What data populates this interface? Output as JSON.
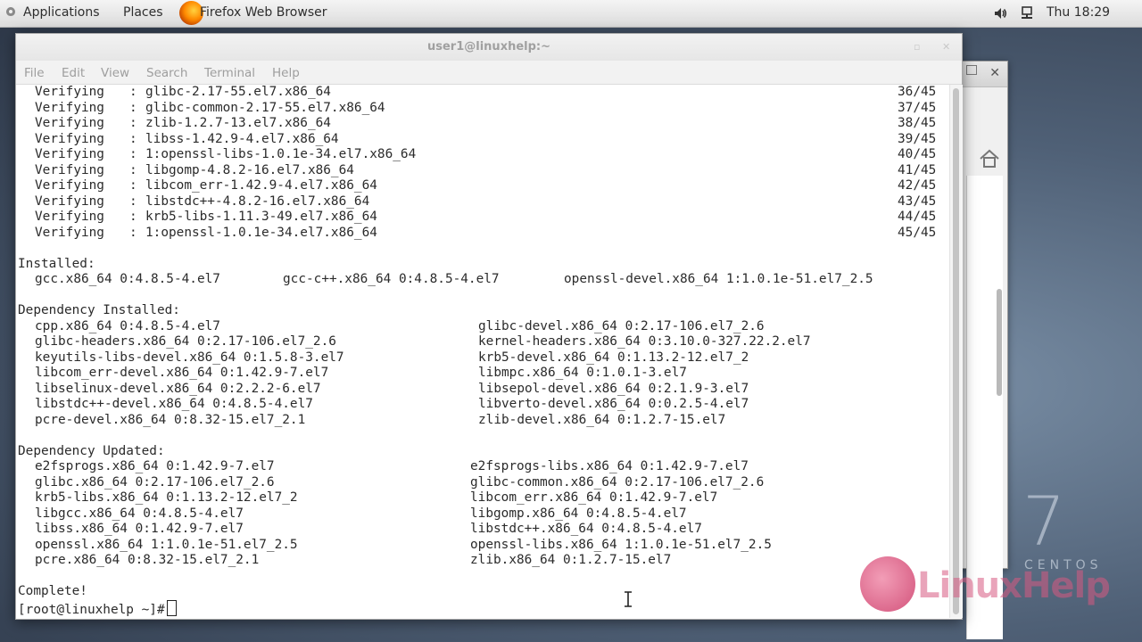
{
  "top_panel": {
    "applications": "Applications",
    "places": "Places",
    "task": "Firefox Web Browser",
    "clock": "Thu 18:29"
  },
  "terminal": {
    "title": "user1@linuxhelp:~",
    "menu": [
      "File",
      "Edit",
      "View",
      "Search",
      "Terminal",
      "Help"
    ],
    "verifying": [
      {
        "pkg": "glibc-2.17-55.el7.x86_64",
        "count": "36/45"
      },
      {
        "pkg": "glibc-common-2.17-55.el7.x86_64",
        "count": "37/45"
      },
      {
        "pkg": "zlib-1.2.7-13.el7.x86_64",
        "count": "38/45"
      },
      {
        "pkg": "libss-1.42.9-4.el7.x86_64",
        "count": "39/45"
      },
      {
        "pkg": "1:openssl-libs-1.0.1e-34.el7.x86_64",
        "count": "40/45"
      },
      {
        "pkg": "libgomp-4.8.2-16.el7.x86_64",
        "count": "41/45"
      },
      {
        "pkg": "libcom_err-1.42.9-4.el7.x86_64",
        "count": "42/45"
      },
      {
        "pkg": "libstdc++-4.8.2-16.el7.x86_64",
        "count": "43/45"
      },
      {
        "pkg": "krb5-libs-1.11.3-49.el7.x86_64",
        "count": "44/45"
      },
      {
        "pkg": "1:openssl-1.0.1e-34.el7.x86_64",
        "count": "45/45"
      }
    ],
    "verifying_label": "Verifying",
    "installed_header": "Installed:",
    "installed": [
      "gcc.x86_64 0:4.8.5-4.el7",
      "gcc-c++.x86_64 0:4.8.5-4.el7",
      "openssl-devel.x86_64 1:1.0.1e-51.el7_2.5"
    ],
    "dep_installed_header": "Dependency Installed:",
    "dep_installed": [
      [
        "cpp.x86_64 0:4.8.5-4.el7",
        "glibc-devel.x86_64 0:2.17-106.el7_2.6"
      ],
      [
        "glibc-headers.x86_64 0:2.17-106.el7_2.6",
        "kernel-headers.x86_64 0:3.10.0-327.22.2.el7"
      ],
      [
        "keyutils-libs-devel.x86_64 0:1.5.8-3.el7",
        "krb5-devel.x86_64 0:1.13.2-12.el7_2"
      ],
      [
        "libcom_err-devel.x86_64 0:1.42.9-7.el7",
        "libmpc.x86_64 0:1.0.1-3.el7"
      ],
      [
        "libselinux-devel.x86_64 0:2.2.2-6.el7",
        "libsepol-devel.x86_64 0:2.1.9-3.el7"
      ],
      [
        "libstdc++-devel.x86_64 0:4.8.5-4.el7",
        "libverto-devel.x86_64 0:0.2.5-4.el7"
      ],
      [
        "pcre-devel.x86_64 0:8.32-15.el7_2.1",
        "zlib-devel.x86_64 0:1.2.7-15.el7"
      ]
    ],
    "dep_updated_header": "Dependency Updated:",
    "dep_updated": [
      [
        "e2fsprogs.x86_64 0:1.42.9-7.el7",
        "e2fsprogs-libs.x86_64 0:1.42.9-7.el7"
      ],
      [
        "glibc.x86_64 0:2.17-106.el7_2.6",
        "glibc-common.x86_64 0:2.17-106.el7_2.6"
      ],
      [
        "krb5-libs.x86_64 0:1.13.2-12.el7_2",
        "libcom_err.x86_64 0:1.42.9-7.el7"
      ],
      [
        "libgcc.x86_64 0:4.8.5-4.el7",
        "libgomp.x86_64 0:4.8.5-4.el7"
      ],
      [
        "libss.x86_64 0:1.42.9-7.el7",
        "libstdc++.x86_64 0:4.8.5-4.el7"
      ],
      [
        "openssl.x86_64 1:1.0.1e-51.el7_2.5",
        "openssl-libs.x86_64 1:1.0.1e-51.el7_2.5"
      ],
      [
        "pcre.x86_64 0:8.32-15.el7_2.1",
        "zlib.x86_64 0:1.2.7-15.el7"
      ]
    ],
    "complete": "Complete!",
    "prompt": "[root@linuxhelp ~]#"
  },
  "watermark": {
    "centos_number": "7",
    "centos_text": "CENTOS",
    "brand": "LinuxHelp"
  },
  "icons": [
    "applications-icon",
    "firefox-icon",
    "volume-icon",
    "network-icon",
    "close-icon",
    "home-icon",
    "text-cursor-icon"
  ]
}
